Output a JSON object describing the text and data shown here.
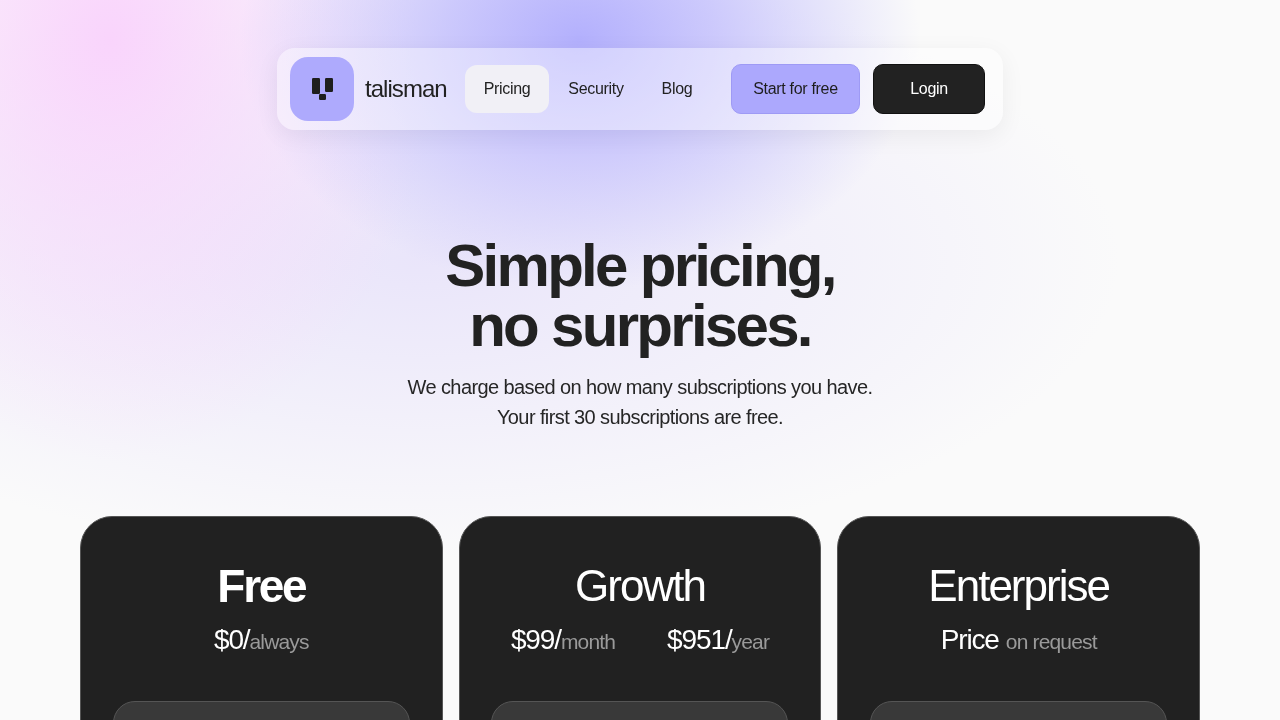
{
  "nav": {
    "logo_text": "talisman",
    "links": [
      {
        "label": "Pricing",
        "selected": true
      },
      {
        "label": "Security",
        "selected": false
      },
      {
        "label": "Blog",
        "selected": false
      }
    ],
    "buttons": [
      {
        "label": "Start for free",
        "kind": "primary"
      },
      {
        "label": "Login",
        "kind": "dark"
      }
    ]
  },
  "hero": {
    "title_lines": [
      "Simple pricing,",
      "no surprises."
    ],
    "subtitle_lines": [
      "We charge based on how many subscriptions you have.",
      "Your first 30 subscriptions are free."
    ]
  },
  "plans": [
    {
      "name": "Free",
      "emphasized": true,
      "prices": [
        {
          "kind": "rate",
          "amount": "$0/",
          "period": "always"
        }
      ]
    },
    {
      "name": "Growth",
      "emphasized": false,
      "prices": [
        {
          "kind": "rate",
          "amount": "$99/",
          "period": "month"
        },
        {
          "kind": "rate",
          "amount": "$951/",
          "period": "year"
        }
      ]
    },
    {
      "name": "Enterprise",
      "emphasized": false,
      "prices": [
        {
          "kind": "note",
          "amount": "Price",
          "period": "on request"
        }
      ]
    }
  ]
}
